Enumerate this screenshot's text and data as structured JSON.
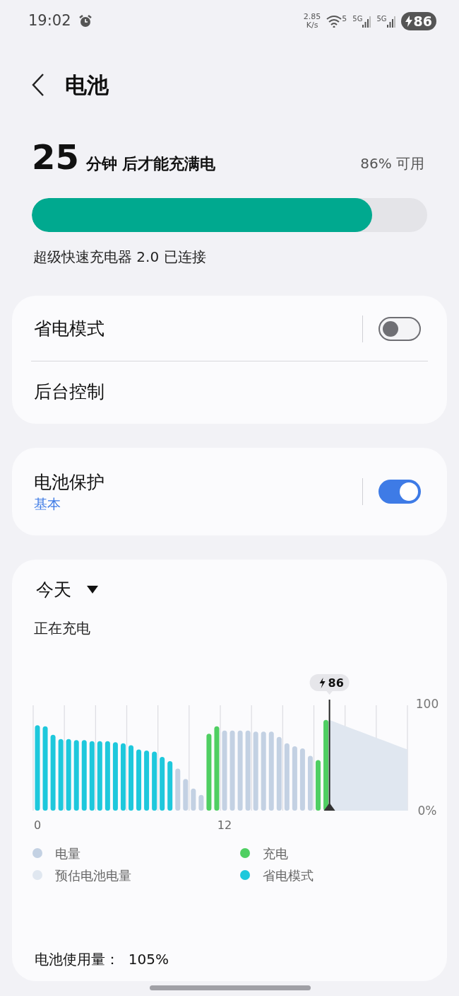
{
  "status_bar": {
    "time": "19:02",
    "net_speed": [
      "2.85",
      "K/s"
    ],
    "wifi_badge": "5",
    "sims": [
      "5G",
      "5G"
    ],
    "battery": "86",
    "charging": true
  },
  "header": {
    "title": "电池"
  },
  "charge": {
    "minutes": "25",
    "suffix": "分钟 后才能充满电",
    "available": "86% 可用",
    "level": 0.86,
    "charger": "超级快速充电器 2.0 已连接"
  },
  "card_power": {
    "items": [
      {
        "kind": "toggle",
        "label": "省电模式",
        "on": false
      },
      {
        "kind": "link",
        "label": "后台控制"
      }
    ]
  },
  "card_protect": {
    "items": [
      {
        "kind": "toggle",
        "label": "电池保护",
        "subtitle": "基本",
        "on": true
      }
    ]
  },
  "usage": {
    "period": "今天",
    "status": "正在充电",
    "chart_data": {
      "type": "bar",
      "x": [
        0,
        0.5,
        1,
        1.5,
        2,
        2.5,
        3,
        3.5,
        4,
        4.5,
        5,
        5.5,
        6,
        6.5,
        7,
        7.5,
        8,
        8.5,
        9,
        9.5,
        10,
        10.5,
        11,
        11.5,
        12,
        12.5,
        13,
        13.5,
        14,
        14.5,
        15,
        15.5,
        16,
        16.5,
        17,
        17.5,
        18,
        18.5,
        19,
        19.5,
        20,
        20.5,
        21,
        21.5,
        22,
        22.5,
        23,
        23.5,
        24
      ],
      "series": [
        {
          "name": "电量",
          "color": "#c3d1e3",
          "values": [
            null,
            null,
            null,
            null,
            null,
            null,
            null,
            null,
            null,
            null,
            null,
            null,
            null,
            null,
            null,
            null,
            null,
            null,
            40,
            30,
            21,
            15,
            null,
            null,
            76,
            76,
            76,
            76,
            75,
            75,
            75,
            70,
            64,
            61,
            59,
            52,
            null,
            null,
            null,
            null,
            null,
            null,
            null,
            null,
            null,
            null,
            null,
            null,
            null
          ]
        },
        {
          "name": "充电",
          "color": "#4fcf62",
          "values": [
            null,
            null,
            null,
            null,
            null,
            null,
            null,
            null,
            null,
            null,
            null,
            null,
            null,
            null,
            null,
            null,
            null,
            null,
            null,
            null,
            null,
            null,
            73,
            80,
            null,
            null,
            null,
            null,
            null,
            null,
            null,
            null,
            null,
            null,
            null,
            null,
            48,
            86,
            null,
            null,
            null,
            null,
            null,
            null,
            null,
            null,
            null,
            null,
            null
          ]
        },
        {
          "name": "预估电池电量",
          "type": "area",
          "color": "#e0e7f0",
          "values": [
            null,
            null,
            null,
            null,
            null,
            null,
            null,
            null,
            null,
            null,
            null,
            null,
            null,
            null,
            null,
            null,
            null,
            null,
            null,
            null,
            null,
            null,
            null,
            null,
            null,
            null,
            null,
            null,
            null,
            null,
            null,
            null,
            null,
            null,
            null,
            null,
            null,
            null,
            86,
            83.2,
            80.4,
            77.6,
            74.8,
            72,
            69.2,
            66.4,
            63.6,
            60.8,
            58
          ]
        },
        {
          "name": "省电模式",
          "color": "#1ec8dc",
          "values": [
            81,
            80,
            72,
            68,
            68,
            67,
            67,
            66,
            66,
            66,
            65,
            64,
            62,
            58,
            57,
            56,
            51,
            47,
            null,
            null,
            null,
            null,
            null,
            null,
            null,
            null,
            null,
            null,
            null,
            null,
            null,
            null,
            null,
            null,
            null,
            null,
            null,
            null,
            null,
            null,
            null,
            null,
            null,
            null,
            null,
            null,
            null,
            null,
            null
          ]
        }
      ],
      "xlim": [
        0,
        24
      ],
      "ylim": [
        0,
        100
      ],
      "xticks": [
        {
          "value": 0,
          "label": "0"
        },
        {
          "value": 12,
          "label": "12"
        }
      ],
      "yticks": [
        {
          "value": 0,
          "label": "0%"
        },
        {
          "value": 100,
          "label": "100"
        }
      ],
      "annotations": [
        {
          "x": 19,
          "text": "86"
        }
      ]
    },
    "total": "电池使用量：  105%"
  }
}
